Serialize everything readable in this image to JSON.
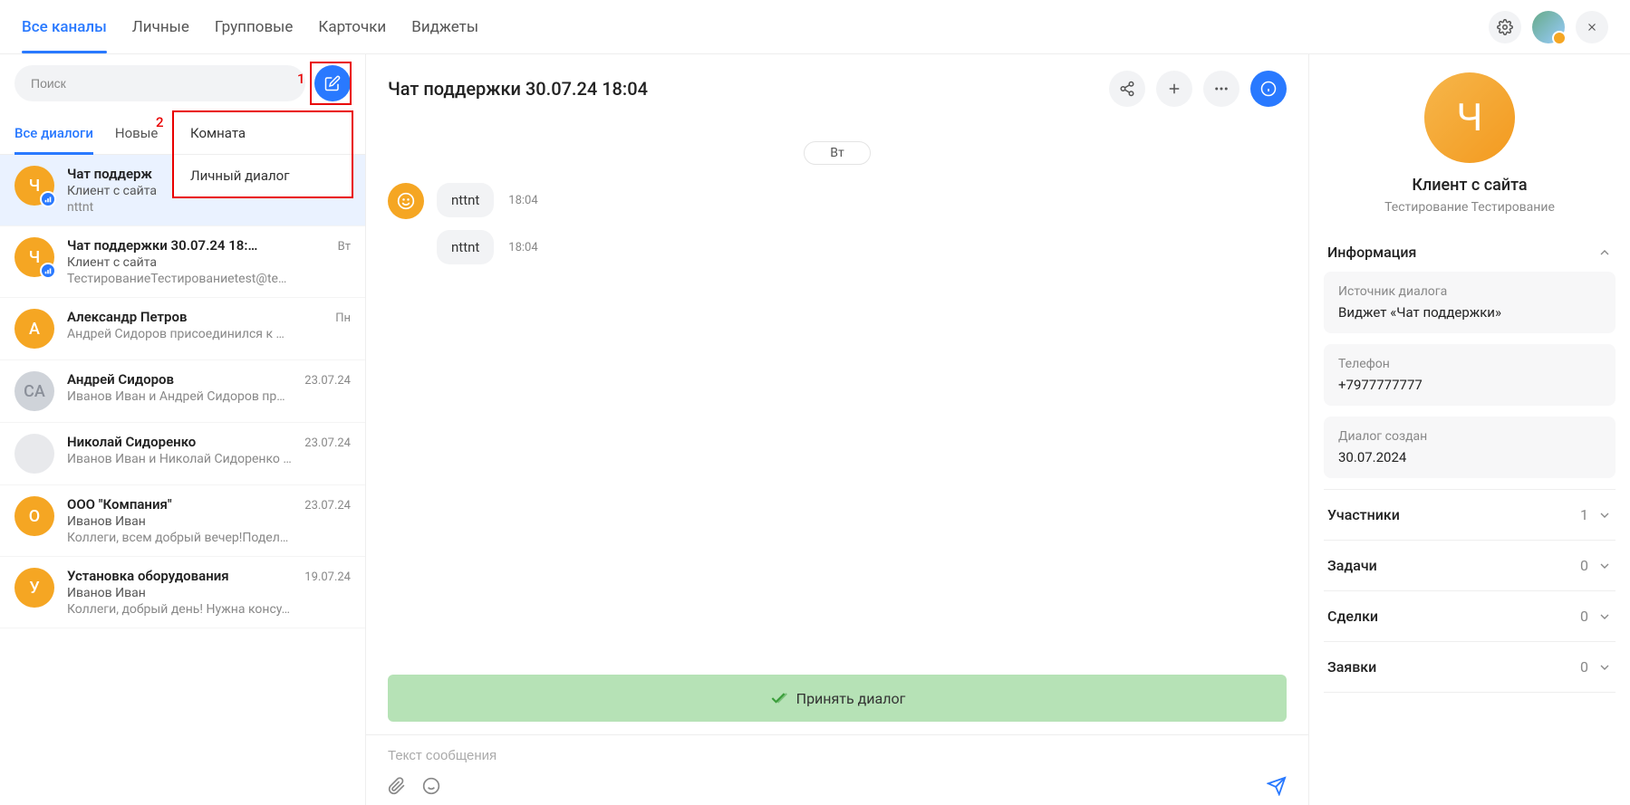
{
  "topnav": {
    "items": [
      "Все каналы",
      "Личные",
      "Групповые",
      "Карточки",
      "Виджеты"
    ],
    "active": 0
  },
  "search": {
    "placeholder": "Поиск"
  },
  "compose_dropdown": {
    "items": [
      "Комната",
      "Личный диалог"
    ]
  },
  "annotations": {
    "one": "1",
    "two": "2"
  },
  "subnav": {
    "items": [
      "Все диалоги",
      "Новые"
    ],
    "active": 0
  },
  "dialogs": [
    {
      "title": "Чат поддерж",
      "sub": "Клиент с сайта",
      "preview": "nttnt",
      "time": "",
      "avatar": "Ч",
      "color": "#f5a623",
      "badge": true,
      "selected": true
    },
    {
      "title": "Чат поддержки 30.07.24 18:…",
      "sub": "Клиент с сайта",
      "preview": "ТестированиеТестированиеtest@te…",
      "time": "Вт",
      "avatar": "Ч",
      "color": "#f5a623",
      "badge": true
    },
    {
      "title": "Александр Петров",
      "sub": "",
      "preview": "Андрей Сидоров присоединился к …",
      "time": "Пн",
      "avatar": "А",
      "color": "#f5a623"
    },
    {
      "title": "Андрей Сидоров",
      "sub": "",
      "preview": "Иванов Иван и Андрей Сидоров пр…",
      "time": "23.07.24",
      "avatar": "СА",
      "color": "#cfd3d9",
      "textcolor": "#8a8f99"
    },
    {
      "title": "Николай Сидоренко",
      "sub": "",
      "preview": "Иванов Иван и Николай Сидоренко …",
      "time": "23.07.24",
      "avatar": "",
      "color": "#e8e9ec"
    },
    {
      "title": "ООО \"Компания\"",
      "sub": "Иванов Иван",
      "preview": "Коллеги, всем добрый вечер!Подел…",
      "time": "23.07.24",
      "avatar": "О",
      "color": "#f5a623"
    },
    {
      "title": "Установка оборудования",
      "sub": "Иванов Иван",
      "preview": "Коллеги, добрый день! Нужна консу…",
      "time": "19.07.24",
      "avatar": "У",
      "color": "#f5a623"
    }
  ],
  "chat": {
    "title": "Чат поддержки 30.07.24 18:04",
    "date_label": "Вт",
    "messages": [
      {
        "text": "nttnt",
        "time": "18:04"
      },
      {
        "text": "nttnt",
        "time": "18:04"
      }
    ],
    "accept_label": "Принять диалог",
    "composer_placeholder": "Текст сообщения"
  },
  "info": {
    "client_name": "Клиент с сайта",
    "client_sub": "Тестирование Тестирование",
    "avatar_letter": "Ч",
    "section_info_title": "Информация",
    "cards": [
      {
        "label": "Источник диалога",
        "value": "Виджет «Чат поддержки»"
      },
      {
        "label": "Телефон",
        "value": "+7977777777"
      },
      {
        "label": "Диалог создан",
        "value": "30.07.2024"
      }
    ],
    "sections": [
      {
        "title": "Участники",
        "count": "1"
      },
      {
        "title": "Задачи",
        "count": "0"
      },
      {
        "title": "Сделки",
        "count": "0"
      },
      {
        "title": "Заявки",
        "count": "0"
      }
    ]
  }
}
